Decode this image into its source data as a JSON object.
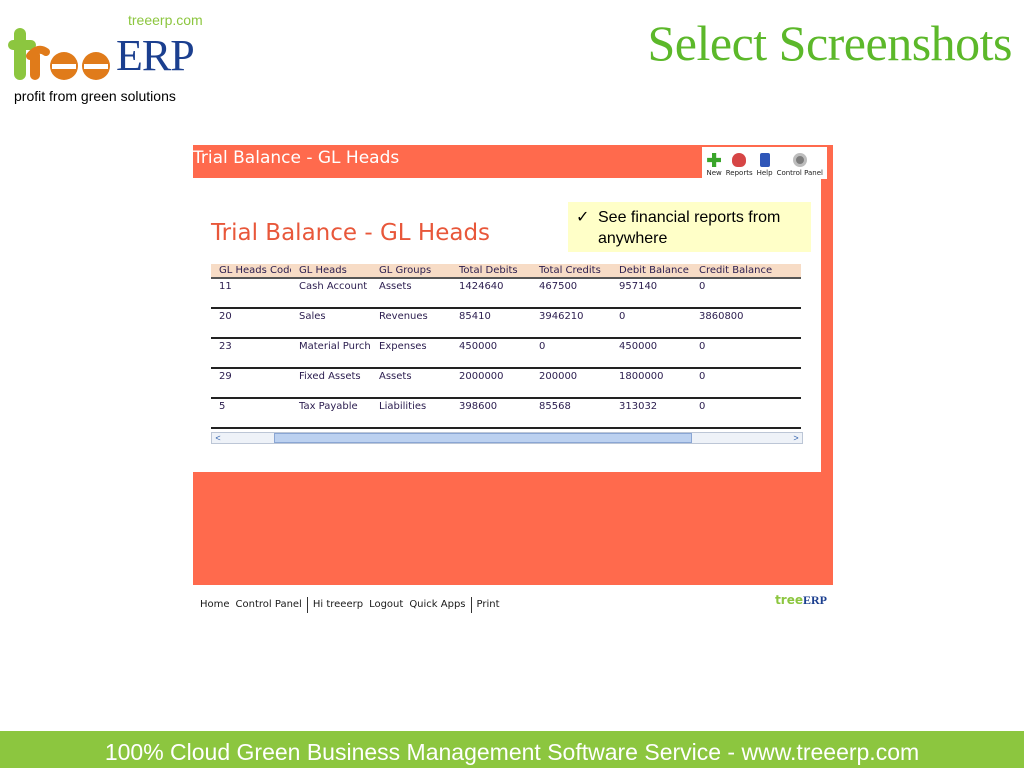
{
  "brand": {
    "site": "treeerp.com",
    "erp": "ERP",
    "tagline": "profit from green solutions"
  },
  "heading": "Select Screenshots",
  "app": {
    "window_title": "Trial Balance - GL Heads",
    "toolbar": [
      {
        "label": "New",
        "icon": "plus-icon",
        "color": "#3aa52a"
      },
      {
        "label": "Reports",
        "icon": "reports-icon",
        "color": "#d64545"
      },
      {
        "label": "Help",
        "icon": "help-book-icon",
        "color": "#2f56b8"
      },
      {
        "label": "Control Panel",
        "icon": "gear-icon",
        "color": "#7d7d7d"
      }
    ],
    "page_title": "Trial Balance - GL Heads",
    "callout": {
      "check": "✓",
      "text": "See financial reports from anywhere"
    },
    "table": {
      "columns": [
        "GL Heads Code",
        "GL Heads",
        "GL Groups",
        "Total Debits",
        "Total Credits",
        "Debit Balance",
        "Credit Balance"
      ],
      "rows": [
        [
          "11",
          "Cash Account",
          "Assets",
          "1424640",
          "467500",
          "957140",
          "0"
        ],
        [
          "20",
          "Sales",
          "Revenues",
          "85410",
          "3946210",
          "0",
          "3860800"
        ],
        [
          "23",
          "Material Purchases",
          "Expenses",
          "450000",
          "0",
          "450000",
          "0"
        ],
        [
          "29",
          "Fixed Assets",
          "Assets",
          "2000000",
          "200000",
          "1800000",
          "0"
        ],
        [
          "5",
          "Tax Payable",
          "Liabilities",
          "398600",
          "85568",
          "313032",
          "0"
        ]
      ]
    },
    "scroll": {
      "left": "<",
      "right": ">"
    },
    "footer_nav": {
      "home": "Home",
      "control_panel": "Control Panel",
      "greeting": "Hi treeerp",
      "logout": "Logout",
      "quick_apps": "Quick Apps",
      "print": "Print"
    },
    "footer_logo": {
      "tree": "tree",
      "erp": "ERP"
    }
  },
  "bottom_banner": "100% Cloud Green Business Management Software Service - www.treeerp.com",
  "colors": {
    "frame": "#ff6a4d",
    "green": "#8cc63f",
    "heading_green": "#5cb82a",
    "navy": "#1b3f8f"
  }
}
